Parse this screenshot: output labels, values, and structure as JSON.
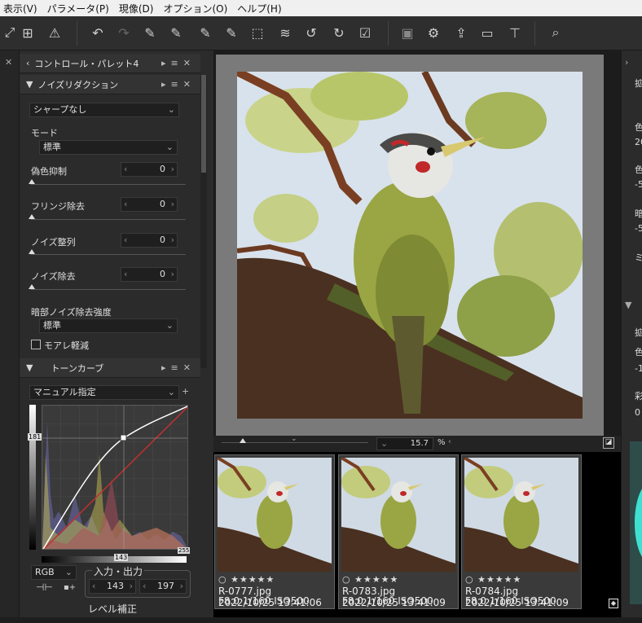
{
  "menu": [
    "表示(V)",
    "パラメータ(P)",
    "現像(D)",
    "オプション(O)",
    "ヘルプ(H)"
  ],
  "control_palette": {
    "title": "コントロール・パレット4"
  },
  "noise_reduction": {
    "title": "ノイズリダクション",
    "sharpen_preset": "シャープなし",
    "mode_label": "モード",
    "mode_value": "標準",
    "rows": [
      {
        "label": "偽色抑制",
        "value": "0"
      },
      {
        "label": "フリンジ除去",
        "value": "0"
      },
      {
        "label": "ノイズ整列",
        "value": "0"
      },
      {
        "label": "ノイズ除去",
        "value": "0"
      }
    ],
    "dark_noise_label": "暗部ノイズ除去強度",
    "dark_noise_value": "標準",
    "moire_label": "モアレ軽減"
  },
  "tone_curve": {
    "title": "トーンカーブ",
    "mode": "マニュアル指定",
    "channel": "RGB",
    "io_label": "入力・出力",
    "input_value": "143",
    "output_value": "197",
    "axis_left": "181",
    "axis_bottom_mid": "143",
    "axis_bottom_right": "255",
    "level_label": "レベル補正"
  },
  "preview": {
    "zoom_value": "15.7",
    "zoom_unit": "%"
  },
  "filmstrip": [
    {
      "file": "R-0777.jpg",
      "date": "2022/10/25 13:41:06",
      "exif": "F8.0 1/160 ISO500",
      "rating": "○ ★★★★★"
    },
    {
      "file": "R-0783.jpg",
      "date": "2022/10/25 13:41:09",
      "exif": "F8.0 1/160 ISO500",
      "rating": "○ ★★★★★"
    },
    {
      "file": "R-0784.jpg",
      "date": "2022/10/25 13:41:09",
      "exif": "F8.0 1/160 ISO500",
      "rating": "○ ★★★★★"
    }
  ],
  "right_panel": {
    "letters": [
      "拡",
      "色",
      "色",
      "暗",
      "ミ",
      "拡",
      "色",
      "彩"
    ],
    "values": [
      "20",
      "-5",
      "-5",
      "-1",
      "0"
    ]
  },
  "icons": [
    "undo-icon",
    "redo-icon",
    "warning-icon",
    "grid-icon",
    "layers-icon",
    "rotate-left-icon",
    "rotate-right-icon",
    "export-icon",
    "zoom-icon"
  ]
}
